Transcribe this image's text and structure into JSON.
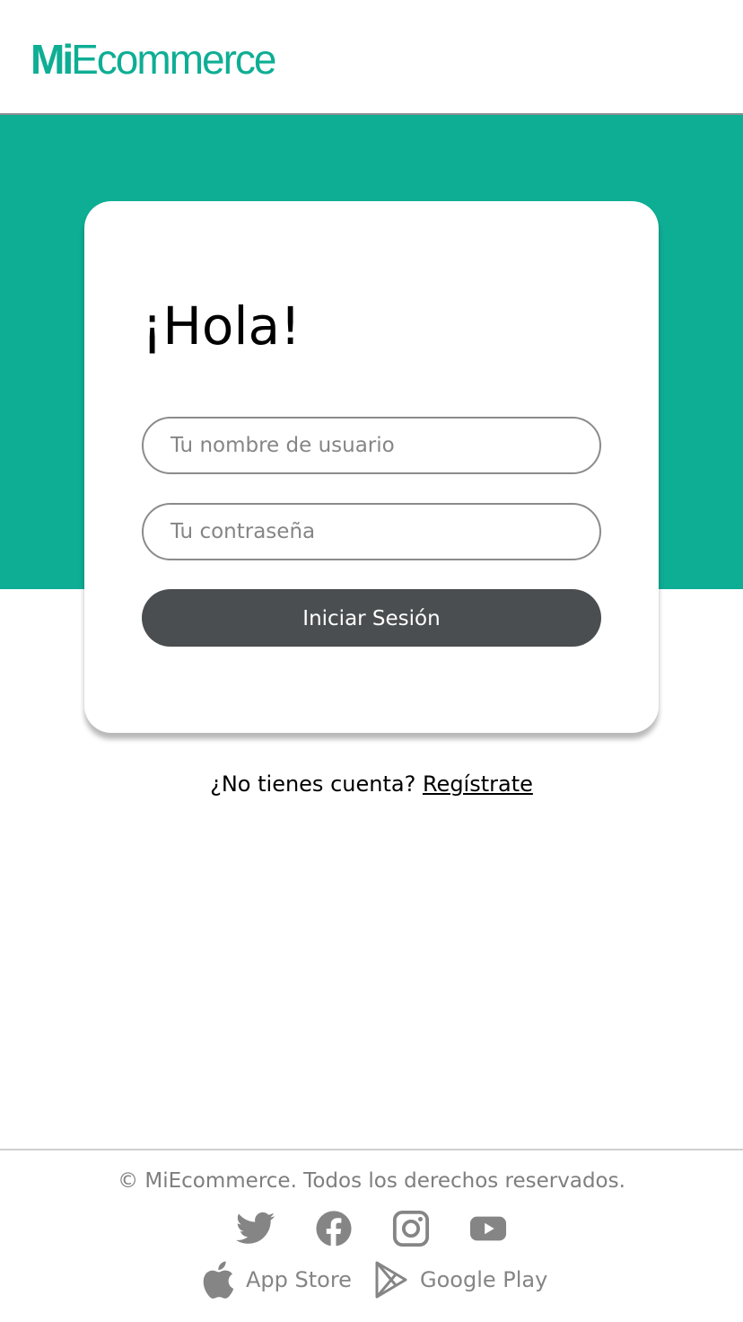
{
  "header": {
    "logo_bold": "Mi",
    "logo_light": "Ecommerce"
  },
  "login": {
    "greeting": "¡Hola!",
    "username_placeholder": "Tu nombre de usuario",
    "username_value": "",
    "password_placeholder": "Tu contraseña",
    "password_value": "",
    "submit_label": "Iniciar Sesión"
  },
  "signup": {
    "prompt": "¿No tienes cuenta?",
    "link_label": "Regístrate"
  },
  "footer": {
    "copyright": "© MiEcommerce. Todos los derechos reservados.",
    "social_icons": [
      "twitter-icon",
      "facebook-icon",
      "instagram-icon",
      "youtube-icon"
    ],
    "stores": {
      "app_store_label": "App Store",
      "google_play_label": "Google Play"
    }
  },
  "colors": {
    "brand": "#0eae94",
    "button": "#4a4e50",
    "footer_text": "#858585"
  }
}
